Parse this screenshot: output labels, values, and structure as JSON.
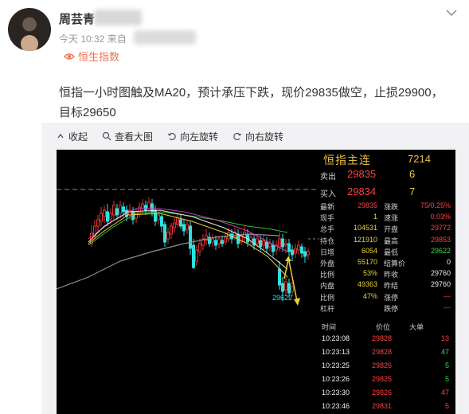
{
  "post": {
    "username": "周芸青",
    "meta": "今天 10:32 来自",
    "topic": "恒生指数",
    "text": "恒指一小时图触及MA20，预计承压下跌，现价29835做空，止损29900，目标29650"
  },
  "toolbar": {
    "collapse": "收起",
    "view_large": "查看大图",
    "rotate_left": "向左旋转",
    "rotate_right": "向右旋转"
  },
  "chart_data": {
    "type": "candlestick",
    "low_label": "29622",
    "series_colors": {
      "up": "#e03030",
      "down": "#30e0e0",
      "ma_fast": "#e8e8e8",
      "ma_mid": "#e8d038",
      "ma_slow": "#c040c0",
      "ma_long": "#30c030",
      "ma_x": "#909090",
      "projection": "#e8d038"
    }
  },
  "quote_panel": {
    "title": "恒指主连",
    "code": "7214",
    "orderbook": [
      {
        "label": "卖出",
        "price": "29835",
        "vol": "6"
      },
      {
        "label": "买入",
        "price": "29834",
        "vol": "7"
      }
    ],
    "rows": [
      {
        "l1": "最新",
        "v1": "29835",
        "c1": "red",
        "l2": "涨跌",
        "v2": "75/0.25%",
        "c2": "red"
      },
      {
        "l1": "现手",
        "v1": "1",
        "c1": "yel",
        "l2": "速涨",
        "v2": "0.03%",
        "c2": "red"
      },
      {
        "l1": "总手",
        "v1": "104531",
        "c1": "yel",
        "l2": "开盘",
        "v2": "29772",
        "c2": "red"
      },
      {
        "l1": "持仓",
        "v1": "121910",
        "c1": "yel",
        "l2": "最高",
        "v2": "29853",
        "c2": "red"
      },
      {
        "l1": "日增",
        "v1": "6054",
        "c1": "yel",
        "l2": "最低",
        "v2": "29622",
        "c2": "grn"
      },
      {
        "l1": "外盘",
        "v1": "55170",
        "c1": "yel",
        "l2": "结算价",
        "v2": "0",
        "c2": "wht"
      },
      {
        "l1": "比例",
        "v1": "53%",
        "c1": "yel",
        "l2": "昨收",
        "v2": "29760",
        "c2": "wht"
      },
      {
        "l1": "内盘",
        "v1": "49363",
        "c1": "yel",
        "l2": "昨结",
        "v2": "29760",
        "c2": "wht"
      },
      {
        "l1": "比例",
        "v1": "47%",
        "c1": "yel",
        "l2": "涨停",
        "v2": "—",
        "c2": "red"
      },
      {
        "l1": "杠杆",
        "v1": "",
        "c1": "yel",
        "l2": "跌停",
        "v2": "—",
        "c2": "red"
      }
    ],
    "tick_headers": {
      "time": "时间",
      "price": "价位",
      "big": "大单"
    },
    "ticks": [
      {
        "time": "10:23:08",
        "price": "29828",
        "vol": "13",
        "c": "red"
      },
      {
        "time": "10:23:13",
        "price": "29828",
        "vol": "47",
        "c": "grn"
      },
      {
        "time": "10:23:25",
        "price": "29826",
        "vol": "5",
        "c": "grn"
      },
      {
        "time": "10:23:26",
        "price": "29825",
        "vol": "5",
        "c": "grn"
      },
      {
        "time": "10:23:30",
        "price": "29826",
        "vol": "47",
        "c": "red"
      },
      {
        "time": "10:23:46",
        "price": "29831",
        "vol": "5",
        "c": "red"
      }
    ]
  }
}
